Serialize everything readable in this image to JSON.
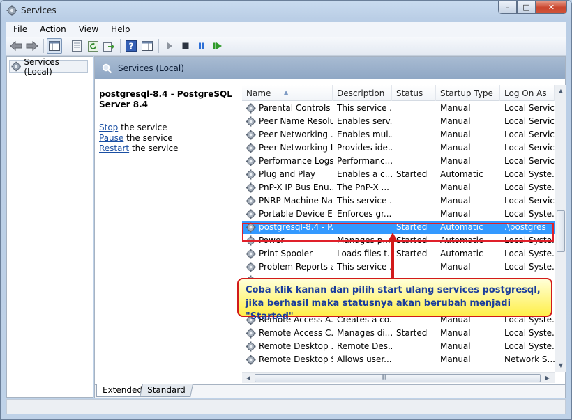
{
  "window": {
    "title": "Services",
    "close_glyph": "✕",
    "minimize_glyph": "–",
    "maximize_glyph": "□"
  },
  "menu": [
    "File",
    "Action",
    "View",
    "Help"
  ],
  "tree": {
    "root_label": "Services (Local)"
  },
  "content_header": "Services (Local)",
  "description": {
    "title": "postgresql-8.4 - PostgreSQL Server 8.4",
    "actions": [
      {
        "link": "Stop",
        "suffix": " the service"
      },
      {
        "link": "Pause",
        "suffix": " the service"
      },
      {
        "link": "Restart",
        "suffix": " the service"
      }
    ]
  },
  "columns": [
    "Name",
    "Description",
    "Status",
    "Startup Type",
    "Log On As"
  ],
  "rows": [
    {
      "name": "Parental Controls",
      "desc": "This service ...",
      "status": "",
      "startup": "Manual",
      "logon": "Local Service"
    },
    {
      "name": "Peer Name Resolu...",
      "desc": "Enables serv...",
      "status": "",
      "startup": "Manual",
      "logon": "Local Service"
    },
    {
      "name": "Peer Networking ...",
      "desc": "Enables mul...",
      "status": "",
      "startup": "Manual",
      "logon": "Local Service"
    },
    {
      "name": "Peer Networking I...",
      "desc": "Provides ide...",
      "status": "",
      "startup": "Manual",
      "logon": "Local Service"
    },
    {
      "name": "Performance Logs...",
      "desc": "Performanc...",
      "status": "",
      "startup": "Manual",
      "logon": "Local Service"
    },
    {
      "name": "Plug and Play",
      "desc": "Enables a c...",
      "status": "Started",
      "startup": "Automatic",
      "logon": "Local Syste..."
    },
    {
      "name": "PnP-X IP Bus Enu...",
      "desc": "The PnP-X ...",
      "status": "",
      "startup": "Manual",
      "logon": "Local Syste..."
    },
    {
      "name": "PNRP Machine Na...",
      "desc": "This service ...",
      "status": "",
      "startup": "Manual",
      "logon": "Local Service"
    },
    {
      "name": "Portable Device E...",
      "desc": "Enforces gr...",
      "status": "",
      "startup": "Manual",
      "logon": "Local Syste..."
    },
    {
      "name": "postgresql-8.4 - P...",
      "desc": "",
      "status": "Started",
      "startup": "Automatic",
      "logon": ".\\postgres"
    },
    {
      "name": "Power",
      "desc": "Manages p...",
      "status": "Started",
      "startup": "Automatic",
      "logon": "Local Syste..."
    },
    {
      "name": "Print Spooler",
      "desc": "Loads files t...",
      "status": "Started",
      "startup": "Automatic",
      "logon": "Local Syste..."
    },
    {
      "name": "Problem Reports a...",
      "desc": "This service ...",
      "status": "",
      "startup": "Manual",
      "logon": "Local Syste..."
    },
    {
      "name": "",
      "desc": "",
      "status": "",
      "startup": "",
      "logon": ""
    },
    {
      "name": "",
      "desc": "",
      "status": "",
      "startup": "",
      "logon": ""
    },
    {
      "name": "",
      "desc": "",
      "status": "",
      "startup": "",
      "logon": ""
    },
    {
      "name": "Remote Access A...",
      "desc": "Creates a co...",
      "status": "",
      "startup": "Manual",
      "logon": "Local Syste..."
    },
    {
      "name": "Remote Access C...",
      "desc": "Manages di...",
      "status": "Started",
      "startup": "Manual",
      "logon": "Local Syste..."
    },
    {
      "name": "Remote Desktop ...",
      "desc": "Remote Des...",
      "status": "",
      "startup": "Manual",
      "logon": "Local Syste..."
    },
    {
      "name": "Remote Desktop S...",
      "desc": "Allows user...",
      "status": "",
      "startup": "Manual",
      "logon": "Network S..."
    }
  ],
  "selected_row_index": 9,
  "tabs": {
    "extended": "Extended",
    "standard": "Standard"
  },
  "callout": {
    "line1": "Coba klik kanan dan pilih start ulang services postgresql,",
    "line2": "jika berhasil maka statusnya akan berubah menjadi \"Started\""
  },
  "colors": {
    "selection": "#3399ff",
    "annotation_red": "#d21a1a",
    "callout_text": "#1a3c9c"
  },
  "icons": {
    "title": "services-gear-icon",
    "toolbar": [
      "back-arrow-icon",
      "forward-arrow-icon",
      "console-tree-icon",
      "properties-icon",
      "refresh-icon",
      "export-list-icon",
      "help-icon",
      "action-pane-icon",
      "play-icon",
      "stop-icon",
      "pause-icon",
      "resume-icon"
    ],
    "row": "service-gear-icon"
  }
}
